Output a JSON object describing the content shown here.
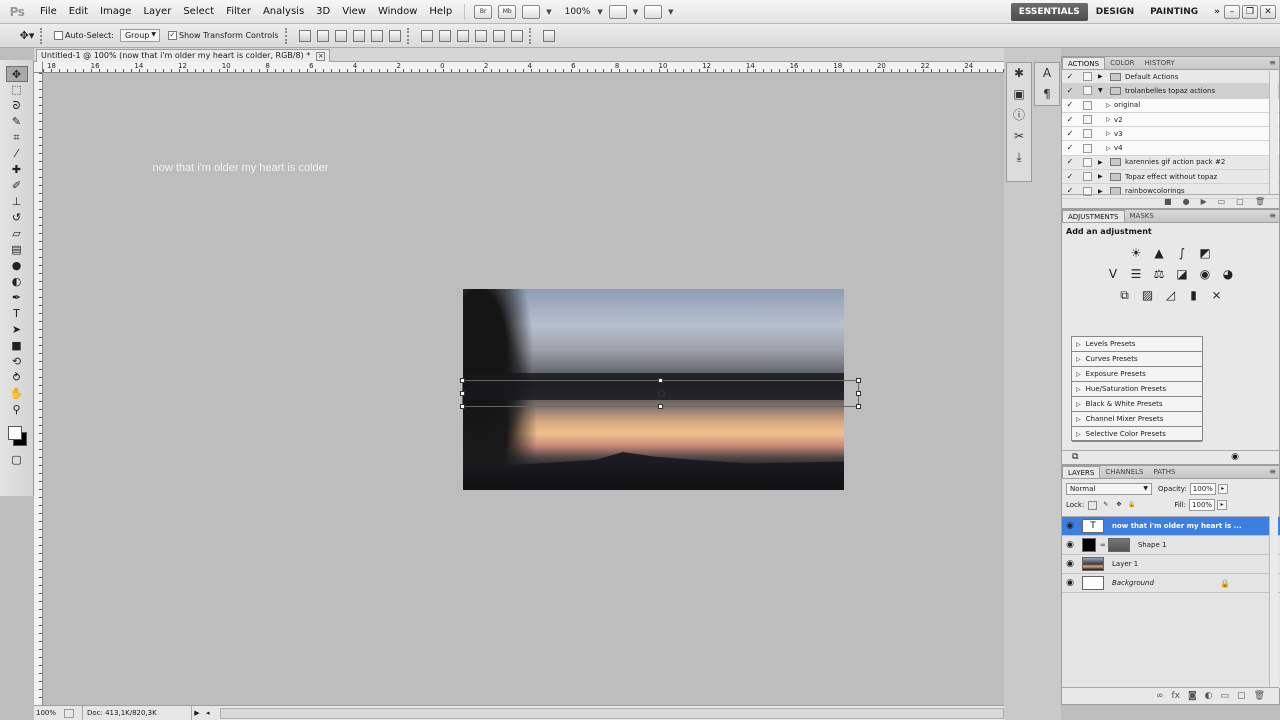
{
  "app": {
    "logo": "Ps"
  },
  "menu": [
    "File",
    "Edit",
    "Image",
    "Layer",
    "Select",
    "Filter",
    "Analysis",
    "3D",
    "View",
    "Window",
    "Help"
  ],
  "menubar_icons": {
    "bridge": "Br",
    "mini_bridge": "Mb"
  },
  "zoom": "100%",
  "workspaces": {
    "essentials": "ESSENTIALS",
    "design": "DESIGN",
    "painting": "PAINTING",
    "more": "»"
  },
  "options": {
    "auto_select_label": "Auto-Select:",
    "auto_select_value": "Group",
    "show_transform_label": "Show Transform Controls"
  },
  "document": {
    "tab_title": "Untitled-1 @ 100% (now that i'm older my heart is colder, RGB/8) *",
    "caption": "now that i'm older my heart is colder"
  },
  "ruler_labels": [
    "18",
    "16",
    "14",
    "12",
    "10",
    "8",
    "6",
    "4",
    "2",
    "0",
    "2",
    "4",
    "6",
    "8",
    "10",
    "12",
    "14",
    "16",
    "18",
    "20",
    "22",
    "24"
  ],
  "status": {
    "zoom": "100%",
    "doc": "Doc: 413,1K/820,3K"
  },
  "colors": {
    "foreground": "#ffffff",
    "background": "#000000",
    "selection": "#3d7fe0"
  },
  "actions_panel": {
    "tabs": [
      "ACTIONS",
      "COLOR",
      "HISTORY"
    ],
    "rows": [
      {
        "label": "Default Actions",
        "type": "set"
      },
      {
        "label": "trolanbelles topaz actions",
        "type": "set"
      },
      {
        "label": "original",
        "type": "action"
      },
      {
        "label": "v2",
        "type": "action"
      },
      {
        "label": "v3",
        "type": "action"
      },
      {
        "label": "v4",
        "type": "action"
      },
      {
        "label": "karennies gif action pack #2",
        "type": "set"
      },
      {
        "label": "Topaz effect without topaz",
        "type": "set"
      },
      {
        "label": "rainbowcolorings",
        "type": "set"
      }
    ]
  },
  "adjustments_panel": {
    "tabs": [
      "ADJUSTMENTS",
      "MASKS"
    ],
    "title": "Add an adjustment",
    "presets": [
      "Levels Presets",
      "Curves Presets",
      "Exposure Presets",
      "Hue/Saturation Presets",
      "Black & White Presets",
      "Channel Mixer Presets",
      "Selective Color Presets"
    ]
  },
  "layers_panel": {
    "tabs": [
      "LAYERS",
      "CHANNELS",
      "PATHS"
    ],
    "blend_mode": "Normal",
    "opacity_label": "Opacity:",
    "opacity": "100%",
    "lock_label": "Lock:",
    "fill_label": "Fill:",
    "fill": "100%",
    "layers": [
      {
        "name": "now that i'm older my heart is ...",
        "thumb": "T",
        "selected": true
      },
      {
        "name": "Shape 1",
        "thumb": "",
        "selected": false
      },
      {
        "name": "Layer 1",
        "thumb": "",
        "selected": false
      },
      {
        "name": "Background",
        "thumb": "",
        "selected": false
      }
    ]
  }
}
